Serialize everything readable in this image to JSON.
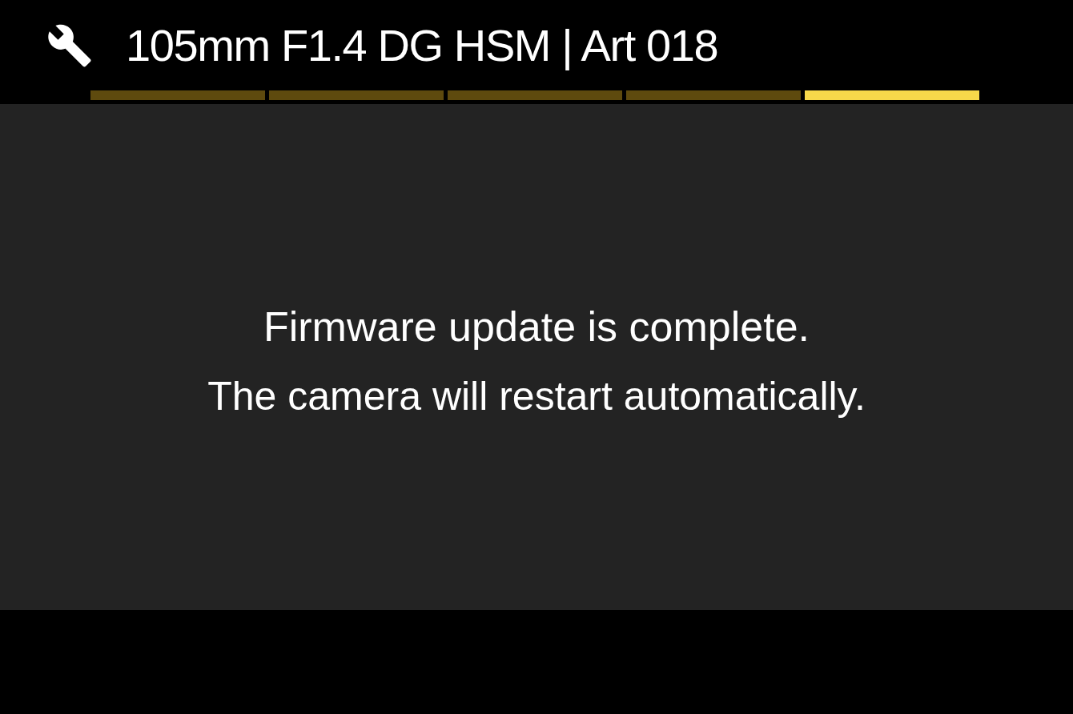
{
  "header": {
    "title": "105mm F1.4 DG HSM | Art 018"
  },
  "segments": [
    {
      "selected": false
    },
    {
      "selected": false
    },
    {
      "selected": false
    },
    {
      "selected": false
    },
    {
      "selected": true
    }
  ],
  "message": {
    "lines": [
      "Firmware update is complete.",
      "The camera will restart automatically."
    ]
  }
}
